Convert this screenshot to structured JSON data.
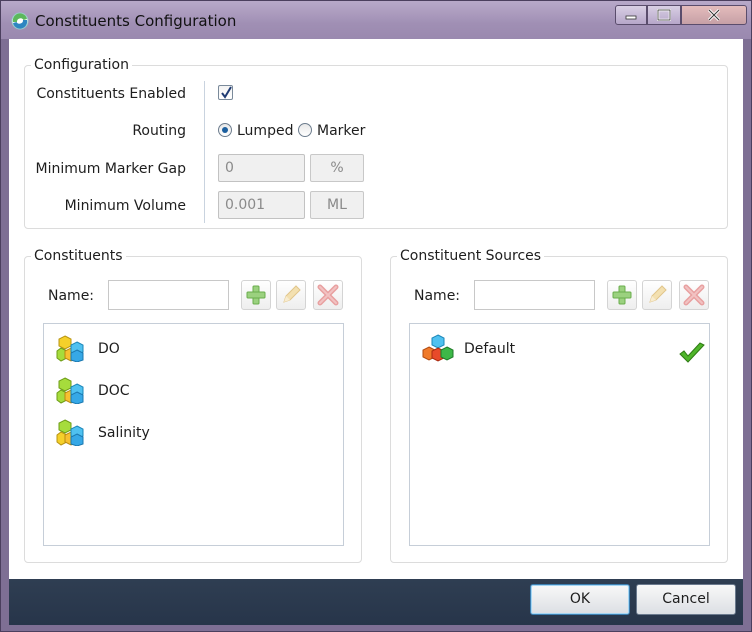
{
  "window": {
    "title": "Constituents Configuration",
    "controls": {
      "minimize": "minimize-icon",
      "maximize": "maximize-icon",
      "close": "close-icon"
    }
  },
  "configuration": {
    "group_title": "Configuration",
    "constituents_enabled": {
      "label": "Constituents Enabled",
      "checked": true
    },
    "routing": {
      "label": "Routing",
      "options": [
        {
          "label": "Lumped",
          "selected": true
        },
        {
          "label": "Marker",
          "selected": false
        }
      ]
    },
    "minimum_marker_gap": {
      "label": "Minimum Marker Gap",
      "value": "0",
      "unit": "%"
    },
    "minimum_volume": {
      "label": "Minimum Volume",
      "value": "0.001",
      "unit": "ML"
    }
  },
  "constituents": {
    "group_title": "Constituents",
    "name_label": "Name:",
    "name_value": "",
    "items": [
      {
        "label": "DO",
        "icon": "cubes-icon"
      },
      {
        "label": "DOC",
        "icon": "cubes-icon"
      },
      {
        "label": "Salinity",
        "icon": "cubes-icon"
      }
    ]
  },
  "sources": {
    "group_title": "Constituent Sources",
    "name_label": "Name:",
    "name_value": "",
    "items": [
      {
        "label": "Default",
        "icon": "cubes-icon",
        "is_default": true
      }
    ]
  },
  "footer": {
    "ok_label": "OK",
    "cancel_label": "Cancel"
  },
  "colors": {
    "title_bar": "#a08fb4",
    "footer": "#2f3e52",
    "radio_selected": "#1c5f9e",
    "check_mark": "#3f9a1f"
  }
}
